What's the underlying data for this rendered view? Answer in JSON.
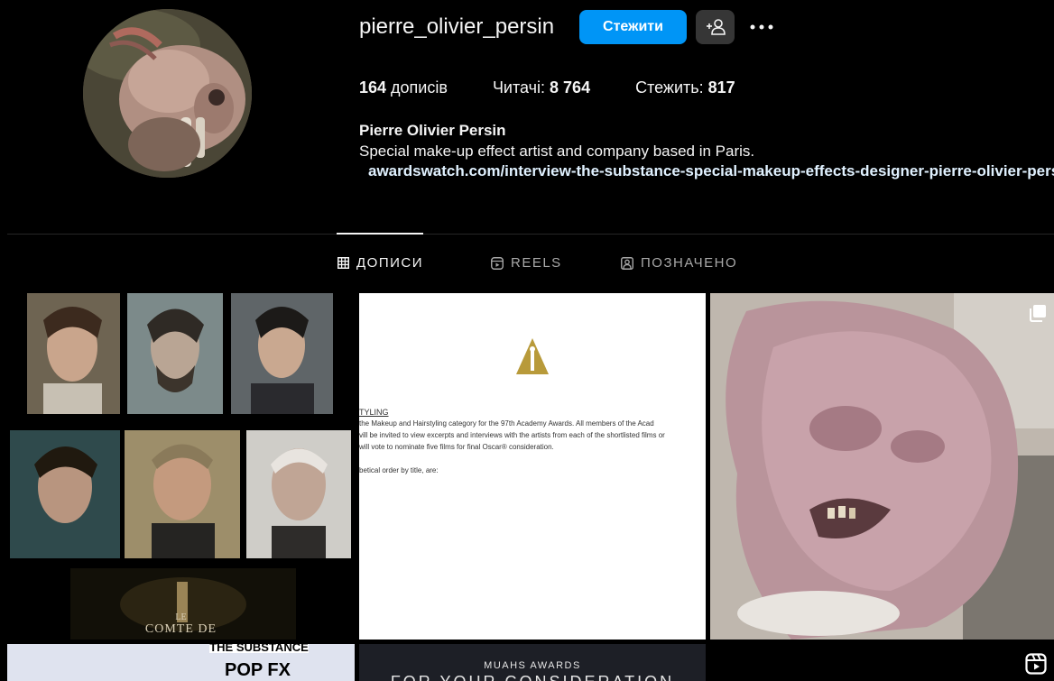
{
  "profile": {
    "username": "pierre_olivier_persin",
    "follow_label": "Стежити",
    "stats": {
      "posts_count": "164",
      "posts_label": " дописів",
      "followers_label": "Читачі: ",
      "followers_count": "8 764",
      "following_label": "Стежить: ",
      "following_count": "817"
    },
    "full_name": "Pierre Olivier Persin",
    "bio": "Special make-up effect artist and company based in Paris.",
    "link": "awardswatch.com/interview-the-substance-special-makeup-effects-designer-pierre-olivier-persin"
  },
  "tabs": [
    {
      "label": "ДОПИСИ",
      "icon": "grid-icon"
    },
    {
      "label": "REELS",
      "icon": "reels-icon"
    },
    {
      "label": "ПОЗНАЧЕНО",
      "icon": "tagged-icon"
    }
  ],
  "posts": {
    "p1": {
      "caption_line1": "LE",
      "caption_line2": "COMTE DE"
    },
    "p2": {
      "line1": "TYLING",
      "line2": " the Makeup and Hairstyling category for the 97th Academy Awards.  All members of the Acad",
      "line3": "vill be invited to view excerpts and interviews with the artists from each of the shortlisted films or",
      "line4": " will vote to nominate five films for final Oscar® consideration.",
      "line5": "betical order by title, are:"
    },
    "p4": {
      "line1": "THE SUBSTANCE",
      "line2": "POP FX"
    },
    "p5": {
      "line1": "MUAHS AWARDS",
      "line2": "FOR YOUR CONSIDERATION"
    }
  },
  "colors": {
    "accent": "#0095f6",
    "background": "#000000",
    "secondary_button": "#363636"
  }
}
